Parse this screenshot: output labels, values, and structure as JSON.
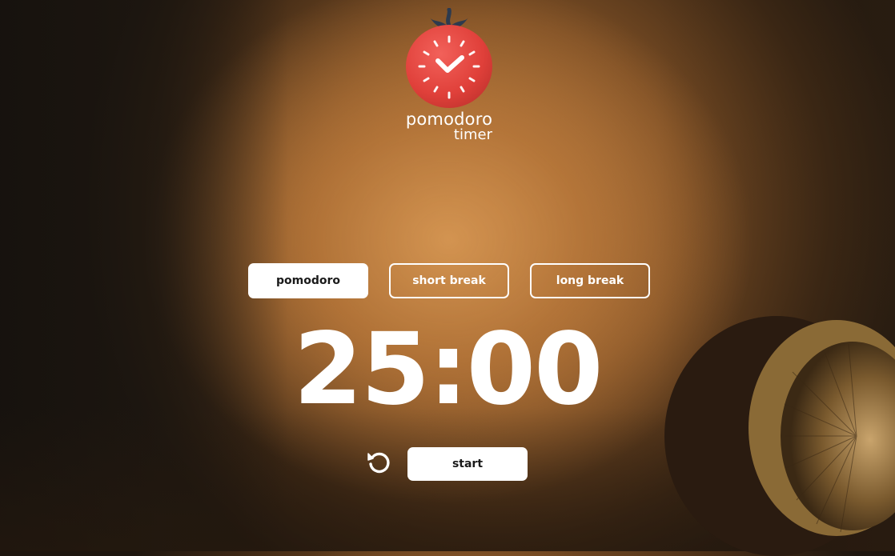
{
  "app": {
    "logo_word": "pomodoro",
    "logo_sub": "timer",
    "logo_icon": "tomato-clock-icon"
  },
  "modes": [
    {
      "label": "pomodoro",
      "active": true
    },
    {
      "label": "short break",
      "active": false
    },
    {
      "label": "long break",
      "active": false
    }
  ],
  "timer": {
    "display": "25:00"
  },
  "controls": {
    "reset_icon": "reset-icon",
    "start_label": "start"
  },
  "colors": {
    "tomato_red": "#e8443e",
    "button_white": "#ffffff",
    "text_dark": "#1a1a1a",
    "stem": "#2d3a4e"
  }
}
